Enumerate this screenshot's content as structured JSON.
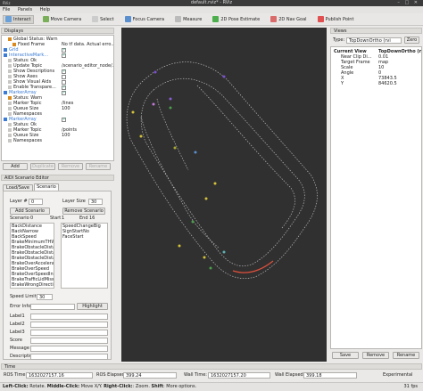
{
  "window": {
    "title": "default.rviz* - RViz",
    "menu_left": "RViz"
  },
  "menu": [
    "File",
    "Panels",
    "Help"
  ],
  "toolbar": [
    {
      "label": "Interact",
      "icon": "interact-icon",
      "color": "#6aa0d8"
    },
    {
      "label": "Move Camera",
      "icon": "camera-icon",
      "color": "#7aaf5a"
    },
    {
      "label": "Select",
      "icon": "select-icon",
      "color": "#cccccc"
    },
    {
      "label": "Focus Camera",
      "icon": "focus-icon",
      "color": "#5a8fcf"
    },
    {
      "label": "Measure",
      "icon": "ruler-icon",
      "color": "#bbbbbb"
    },
    {
      "label": "2D Pose Estimate",
      "icon": "pose-arrow-icon",
      "color": "#4cae4c"
    },
    {
      "label": "2D Nav Goal",
      "icon": "nav-goal-icon",
      "color": "#d96b6b"
    },
    {
      "label": "Publish Point",
      "icon": "pin-icon",
      "color": "#e05050"
    }
  ],
  "displays": {
    "title": "Displays",
    "rows": [
      {
        "indent": 1,
        "label": "Global Status: Warn",
        "value": "",
        "color": "#d98a1a"
      },
      {
        "indent": 2,
        "label": "Fixed Frame",
        "value": "No tf data.  Actual erro...",
        "color": "#d98a1a"
      },
      {
        "indent": 0,
        "label": "Grid",
        "value": "",
        "color": "#3a7bd5",
        "check": true
      },
      {
        "indent": 0,
        "label": "InteractiveMark...",
        "value": "",
        "color": "#3a7bd5",
        "check": true
      },
      {
        "indent": 1,
        "label": "Status: Ok",
        "value": "",
        "color": ""
      },
      {
        "indent": 1,
        "label": "Update Topic",
        "value": "/scenario_editor_node/...",
        "color": ""
      },
      {
        "indent": 1,
        "label": "Show Descriptions",
        "value": "",
        "color": "",
        "check": true
      },
      {
        "indent": 1,
        "label": "Show Axes",
        "value": "",
        "color": "",
        "check": false
      },
      {
        "indent": 1,
        "label": "Show Visual Aids",
        "value": "",
        "color": "",
        "check": false
      },
      {
        "indent": 1,
        "label": "Enable Transpare...",
        "value": "",
        "color": "",
        "check": true
      },
      {
        "indent": 0,
        "label": "MarkerArray",
        "value": "",
        "color": "#3a7bd5",
        "check": true
      },
      {
        "indent": 1,
        "label": "Status: Warn",
        "value": "",
        "color": "#d98a1a"
      },
      {
        "indent": 1,
        "label": "Marker Topic",
        "value": "/lines",
        "color": ""
      },
      {
        "indent": 1,
        "label": "Queue Size",
        "value": "100",
        "color": ""
      },
      {
        "indent": 1,
        "label": "Namespaces",
        "value": "",
        "color": ""
      },
      {
        "indent": 0,
        "label": "MarkerArray",
        "value": "",
        "color": "#3a7bd5",
        "check": true
      },
      {
        "indent": 1,
        "label": "Status: Ok",
        "value": "",
        "color": ""
      },
      {
        "indent": 1,
        "label": "Marker Topic",
        "value": "/points",
        "color": ""
      },
      {
        "indent": 1,
        "label": "Queue Size",
        "value": "100",
        "color": ""
      },
      {
        "indent": 1,
        "label": "Namespaces",
        "value": "",
        "color": ""
      }
    ],
    "buttons": [
      "Add",
      "Duplicate",
      "Remove",
      "Rename"
    ]
  },
  "editor": {
    "title": "AIDI Scenario Editor",
    "tabs": [
      "Load/Save",
      "Scenario"
    ],
    "layer_label": "Layer #",
    "layer_value": "0",
    "layer_size_label": "Layer Size",
    "layer_size_value": "30",
    "add_scenario": "Add Scenario",
    "remove_scenario": "Remove Scenario",
    "scenario_label": "Scenario",
    "scenario_value": "0",
    "start_label": "Start",
    "start_value": "1",
    "end_label": "End",
    "end_value": "16",
    "left_list": [
      "BackDistance",
      "BackNarrow",
      "BackSpeed",
      "BrakeMinimumTHW",
      "BrakeObstacleDista",
      "BrakeObstacleDista",
      "BrakeObstacleDista",
      "BrakeOverAccelerati",
      "BrakeOverSpeed",
      "BrakeOverSpeedInt",
      "BrakeTrafficLidMiss",
      "BrakeWrongDirectio"
    ],
    "right_list": [
      "SpeedChangeBig",
      "SignStartNo",
      "FaceStart"
    ],
    "speed_limit_label": "Speed Limit",
    "speed_limit_value": "30",
    "error_info_label": "Error Info",
    "highlight_btn": "Highlight",
    "fields": [
      "Label1",
      "Label2",
      "Label3",
      "Score",
      "Message",
      "Description"
    ]
  },
  "views": {
    "title": "Views",
    "type_label": "Type:",
    "type_value": "TopDownOrtho (rvi",
    "zero_btn": "Zero",
    "rows": [
      {
        "label": "Current View",
        "value": "TopDownOrtho (rvi",
        "bold": true
      },
      {
        "label": "Near Clip Di...",
        "value": "0.01"
      },
      {
        "label": "Target Frame",
        "value": "map"
      },
      {
        "label": "Scale",
        "value": "10"
      },
      {
        "label": "Angle",
        "value": "0"
      },
      {
        "label": "X",
        "value": "73843.5"
      },
      {
        "label": "Y",
        "value": "84620.5"
      }
    ],
    "buttons": [
      "Save",
      "Remove",
      "Rename"
    ]
  },
  "time": {
    "title": "Time",
    "ros_time_label": "ROS Time:",
    "ros_time": "1632027157.16",
    "ros_elapsed_label": "ROS Elapsed:",
    "ros_elapsed": "399.24",
    "wall_time_label": "Wall Time:",
    "wall_time": "1632027157.20",
    "wall_elapsed_label": "Wall Elapsed:",
    "wall_elapsed": "399.18",
    "experimental": "Experimental"
  },
  "status": {
    "left_click": "Left-Click:",
    "left_desc": " Rotate. ",
    "middle_click": "Middle-Click:",
    "middle_desc": " Move X/Y. ",
    "right_click": "Right-Click:",
    "right_desc": ": Zoom. ",
    "shift": "Shift",
    "shift_desc": ": More options.",
    "fps": "31 fps"
  },
  "colors": {
    "viewport_bg": "#303030",
    "track": "#bdbdbd",
    "highlight": "#e0503c"
  }
}
